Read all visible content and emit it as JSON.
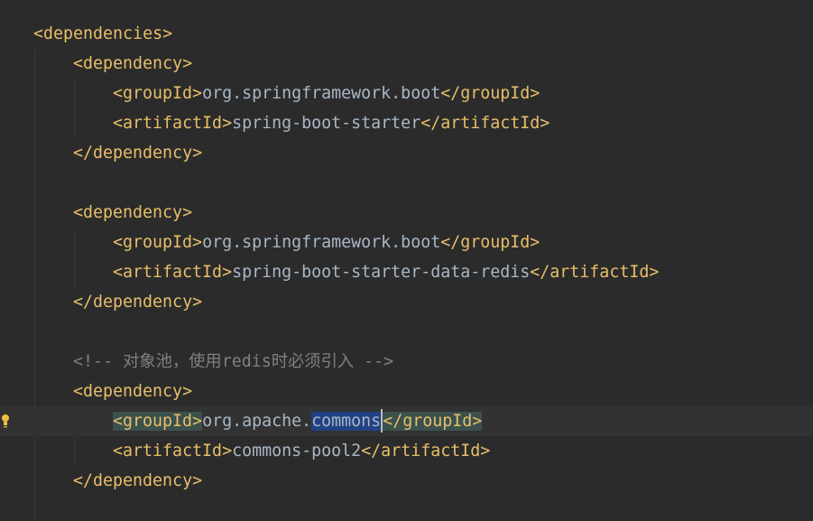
{
  "editor": {
    "lines": [
      {
        "open": "<dependencies>"
      },
      {
        "open": "<dependency>"
      },
      {
        "open": "<groupId>",
        "value": "org.springframework.boot",
        "close": "</groupId>"
      },
      {
        "open": "<artifactId>",
        "value": "spring-boot-starter",
        "close": "</artifactId>"
      },
      {
        "close": "</dependency>"
      },
      {},
      {
        "open": "<dependency>"
      },
      {
        "open": "<groupId>",
        "value": "org.springframework.boot",
        "close": "</groupId>"
      },
      {
        "open": "<artifactId>",
        "value": "spring-boot-starter-data-redis",
        "close": "</artifactId>"
      },
      {
        "close": "</dependency>"
      },
      {},
      {
        "comment": "<!-- 对象池，使用redis时必须引入 -->"
      },
      {
        "open": "<dependency>"
      },
      {
        "open": "<groupId>",
        "value_pre": "org.apache.",
        "value_sel": "commons",
        "close": "</groupId>"
      },
      {
        "open": "<artifactId>",
        "value": "commons-pool2",
        "close": "</artifactId>"
      },
      {
        "close": "</dependency>"
      }
    ]
  },
  "colors": {
    "background": "#2b2b2b",
    "tag": "#e8bf6a",
    "text": "#a9b7c6",
    "comment": "#808080",
    "selection": "#214283",
    "current_line": "#323232"
  },
  "icons": {
    "gutter": "lightbulb-icon"
  }
}
